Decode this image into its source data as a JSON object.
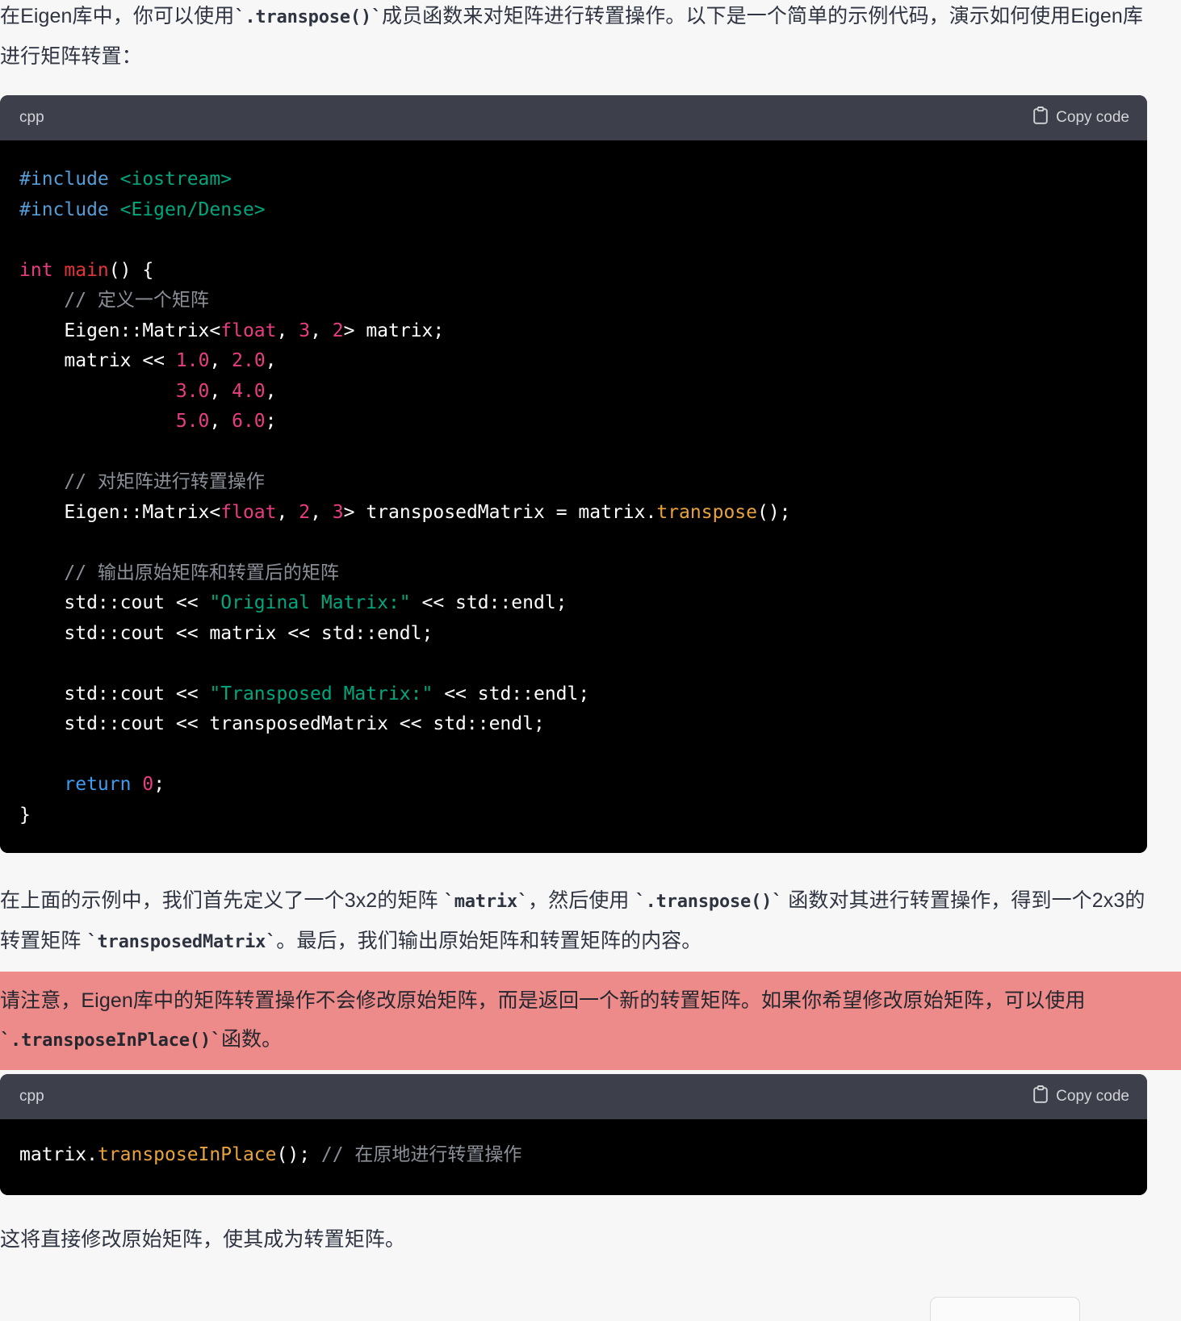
{
  "theme": {
    "page_bg": "#f7f7f8",
    "text_color": "#2f3441",
    "code_header_bg": "#3d3f4b",
    "code_body_bg": "#000000",
    "highlight_bg": "#ed8a8a",
    "accent_string": "#00a67d",
    "accent_keyword": "#e93d82",
    "accent_method": "#e8a33d",
    "accent_return": "#3f9cf0",
    "accent_preproc": "#569cd6",
    "accent_comment": "#8a8f98"
  },
  "paragraphs": {
    "intro_a": "在Eigen库中，你可以使用",
    "intro_code": "`.transpose()`",
    "intro_b": "成员函数来对矩阵进行转置操作。以下是一个简单的示例代码，演示如何使用Eigen库进行矩阵转置：",
    "middle_a": "在上面的示例中，我们首先定义了一个3x2的矩阵 ",
    "middle_code1": "`matrix`",
    "middle_b": "，然后使用 ",
    "middle_code2": "`.transpose()`",
    "middle_c": " 函数对其进行转置操作，得到一个2x3的转置矩阵 ",
    "middle_code3": "`transposedMatrix`",
    "middle_d": "。最后，我们输出原始矩阵和转置矩阵的内容。",
    "note_a": "请注意，Eigen库中的矩阵转置操作不会修改原始矩阵，而是返回一个新的转置矩阵。如果你希望修改原始矩阵，可以使用",
    "note_code": "`.transposeInPlace()`",
    "note_b": "函数。",
    "closing": "这将直接修改原始矩阵，使其成为转置矩阵。"
  },
  "code_blocks": [
    {
      "language_label": "cpp",
      "copy_label": "Copy code",
      "copy_icon": "clipboard-icon",
      "lines": [
        "#include <iostream>",
        "#include <Eigen/Dense>",
        "",
        "int main() {",
        "    // 定义一个矩阵",
        "    Eigen::Matrix<float, 3, 2> matrix;",
        "    matrix << 1.0, 2.0,",
        "              3.0, 4.0,",
        "              5.0, 6.0;",
        "",
        "    // 对矩阵进行转置操作",
        "    Eigen::Matrix<float, 2, 3> transposedMatrix = matrix.transpose();",
        "",
        "    // 输出原始矩阵和转置后的矩阵",
        "    std::cout << \"Original Matrix:\" << std::endl;",
        "    std::cout << matrix << std::endl;",
        "",
        "    std::cout << \"Transposed Matrix:\" << std::endl;",
        "    std::cout << transposedMatrix << std::endl;",
        "",
        "    return 0;",
        "}"
      ]
    },
    {
      "language_label": "cpp",
      "copy_label": "Copy code",
      "copy_icon": "clipboard-icon",
      "lines": [
        "matrix.transposeInPlace(); // 在原地进行转置操作"
      ]
    }
  ],
  "code_tokens": {
    "block1": {
      "l1_pre": "#include",
      "l1_inc": " <iostream>",
      "l2_pre": "#include",
      "l2_inc": " <Eigen/Dense>",
      "l4_kw": "int",
      "l4_fn": " main",
      "l4_rest": "() {",
      "l5_cmt": "    // 定义一个矩阵",
      "l6_a": "    Eigen::Matrix<",
      "l6_kw": "float",
      "l6_b": ", ",
      "l6_n1": "3",
      "l6_c": ", ",
      "l6_n2": "2",
      "l6_d": "> matrix;",
      "l7_a": "    matrix << ",
      "l7_n": "1.0",
      "l7_b": ", ",
      "l7_n2": "2.0",
      "l7_c": ",",
      "l8_n1": "              3.0",
      "l8_b": ", ",
      "l8_n2": "4.0",
      "l8_c": ",",
      "l9_n1": "              5.0",
      "l9_b": ", ",
      "l9_n2": "6.0",
      "l9_c": ";",
      "l11_cmt": "    // 对矩阵进行转置操作",
      "l12_a": "    Eigen::Matrix<",
      "l12_kw": "float",
      "l12_b": ", ",
      "l12_n1": "2",
      "l12_c": ", ",
      "l12_n2": "3",
      "l12_d": "> transposedMatrix = matrix.",
      "l12_meth": "transpose",
      "l12_e": "();",
      "l14_cmt": "    // 输出原始矩阵和转置后的矩阵",
      "l15_a": "    std::cout << ",
      "l15_str": "\"Original Matrix:\"",
      "l15_b": " << std::endl;",
      "l16_a": "    std::cout << matrix << std::endl;",
      "l18_a": "    std::cout << ",
      "l18_str": "\"Transposed Matrix:\"",
      "l18_b": " << std::endl;",
      "l19_a": "    std::cout << transposedMatrix << std::endl;",
      "l21_ret": "    return",
      "l21_n": " 0",
      "l21_b": ";",
      "l22_a": "}"
    },
    "block2": {
      "a": "matrix.",
      "meth": "transposeInPlace",
      "b": "(); ",
      "cmt": "// 在原地进行转置操作"
    }
  }
}
